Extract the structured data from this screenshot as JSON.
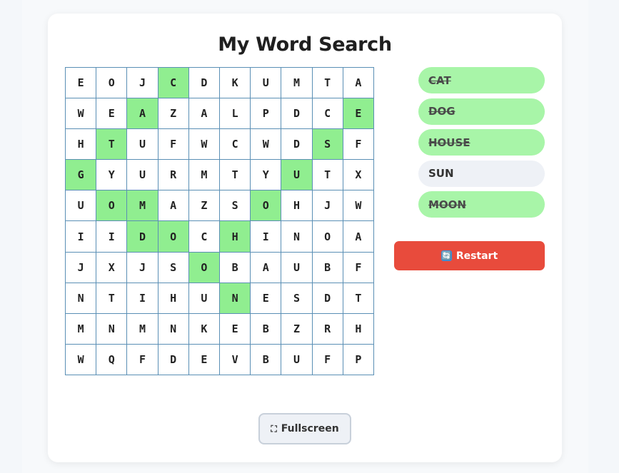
{
  "title": "My Word Search",
  "grid": [
    [
      "E",
      "O",
      "J",
      "C",
      "D",
      "K",
      "U",
      "M",
      "T",
      "A"
    ],
    [
      "W",
      "E",
      "A",
      "Z",
      "A",
      "L",
      "P",
      "D",
      "C",
      "E"
    ],
    [
      "H",
      "T",
      "U",
      "F",
      "W",
      "C",
      "W",
      "D",
      "S",
      "F"
    ],
    [
      "G",
      "Y",
      "U",
      "R",
      "M",
      "T",
      "Y",
      "U",
      "T",
      "X"
    ],
    [
      "U",
      "O",
      "M",
      "A",
      "Z",
      "S",
      "O",
      "H",
      "J",
      "W"
    ],
    [
      "I",
      "I",
      "D",
      "O",
      "C",
      "H",
      "I",
      "N",
      "O",
      "A"
    ],
    [
      "J",
      "X",
      "J",
      "S",
      "O",
      "B",
      "A",
      "U",
      "B",
      "F"
    ],
    [
      "N",
      "T",
      "I",
      "H",
      "U",
      "N",
      "E",
      "S",
      "D",
      "T"
    ],
    [
      "M",
      "N",
      "M",
      "N",
      "K",
      "E",
      "B",
      "Z",
      "R",
      "H"
    ],
    [
      "W",
      "Q",
      "F",
      "D",
      "E",
      "V",
      "B",
      "U",
      "F",
      "P"
    ]
  ],
  "found_cells": [
    [
      0,
      3
    ],
    [
      1,
      2
    ],
    [
      2,
      1
    ],
    [
      3,
      0
    ],
    [
      1,
      9
    ],
    [
      2,
      8
    ],
    [
      3,
      7
    ],
    [
      4,
      6
    ],
    [
      4,
      1
    ],
    [
      4,
      2
    ],
    [
      5,
      2
    ],
    [
      5,
      3
    ],
    [
      5,
      5
    ],
    [
      6,
      4
    ],
    [
      7,
      5
    ]
  ],
  "words": [
    {
      "label": "CAT",
      "found": true
    },
    {
      "label": "DOG",
      "found": true
    },
    {
      "label": "HOUSE",
      "found": true
    },
    {
      "label": "SUN",
      "found": false
    },
    {
      "label": "MOON",
      "found": true
    }
  ],
  "buttons": {
    "restart_label": "Restart",
    "restart_icon": "🔄",
    "fullscreen_label": "Fullscreen",
    "fullscreen_icon": "⛶"
  },
  "colors": {
    "found_cell": "#90ee90",
    "found_word": "#a8f5a8",
    "restart": "#e84b3c",
    "grid_border": "#5a8fb5"
  }
}
